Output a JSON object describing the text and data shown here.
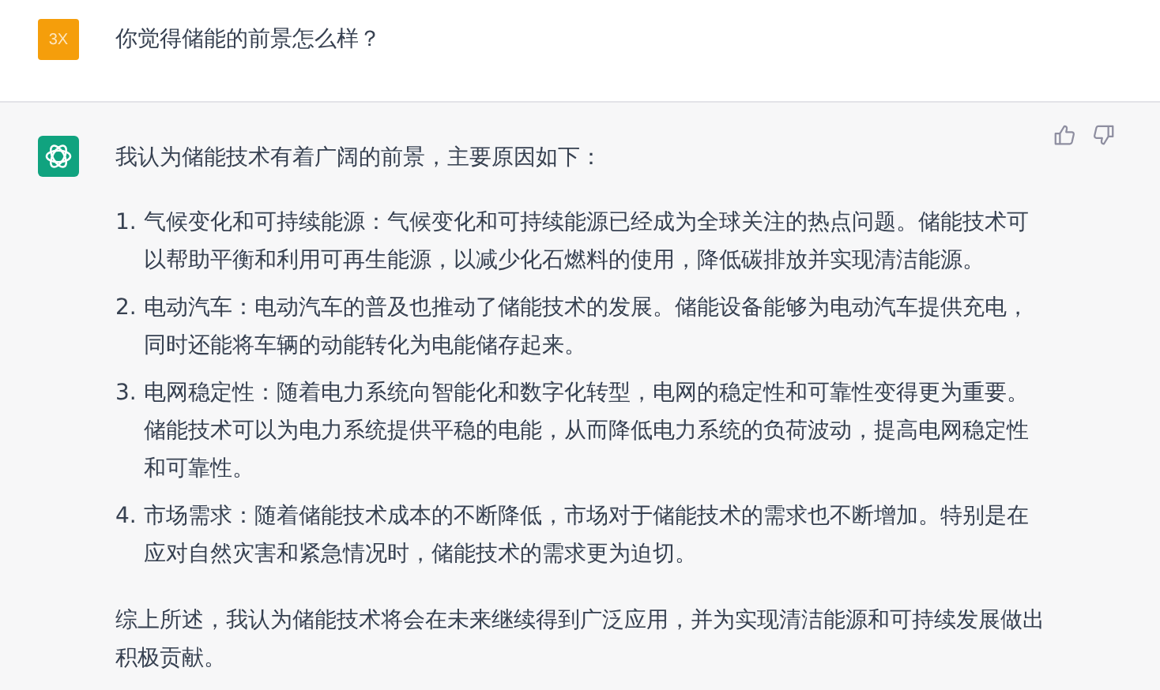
{
  "user_message": {
    "avatar": "3X",
    "text": "你觉得储能的前景怎么样？"
  },
  "assistant_message": {
    "intro": "我认为储能技术有着广阔的前景，主要原因如下：",
    "points": [
      {
        "number": "1.",
        "text": "气候变化和可持续能源：气候变化和可持续能源已经成为全球关注的热点问题。储能技术可以帮助平衡和利用可再生能源，以减少化石燃料的使用，降低碳排放并实现清洁能源。"
      },
      {
        "number": "2.",
        "text": "电动汽车：电动汽车的普及也推动了储能技术的发展。储能设备能够为电动汽车提供充电，同时还能将车辆的动能转化为电能储存起来。"
      },
      {
        "number": "3.",
        "text": "电网稳定性：随着电力系统向智能化和数字化转型，电网的稳定性和可靠性变得更为重要。储能技术可以为电力系统提供平稳的电能，从而降低电力系统的负荷波动，提高电网稳定性和可靠性。"
      },
      {
        "number": "4.",
        "text": "市场需求：随着储能技术成本的不断降低，市场对于储能技术的需求也不断增加。特别是在应对自然灾害和紧急情况时，储能技术的需求更为迫切。"
      }
    ],
    "conclusion": "综上所述，我认为储能技术将会在未来继续得到广泛应用，并为实现清洁能源和可持续发展做出积极贡献。"
  }
}
